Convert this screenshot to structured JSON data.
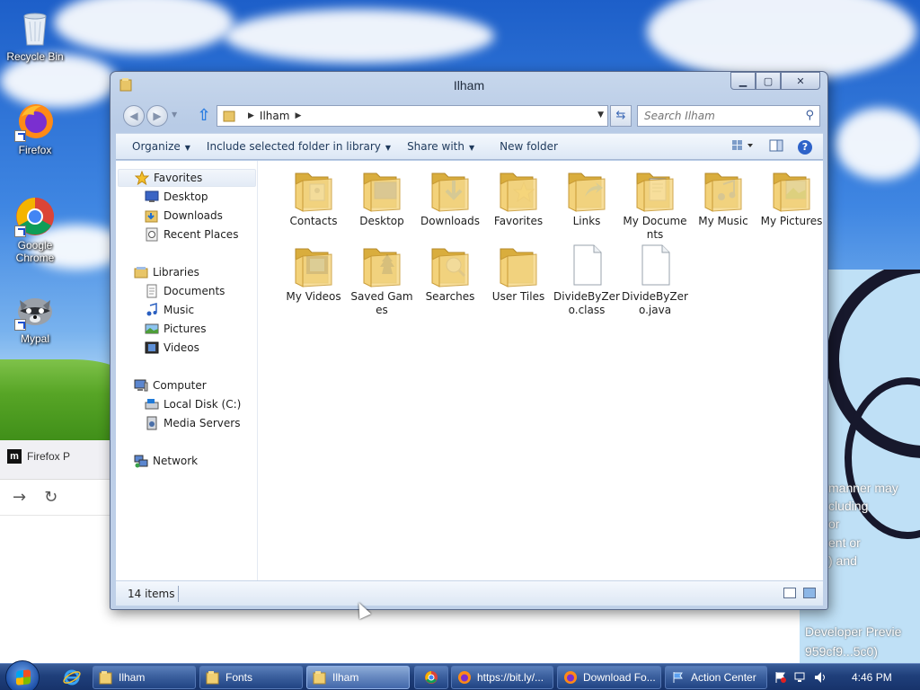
{
  "desktop": {
    "icons": [
      {
        "label": "Recycle Bin"
      },
      {
        "label": "Firefox"
      },
      {
        "label": "Google Chrome"
      },
      {
        "label": "Mypal"
      }
    ],
    "background_text": {
      "lines": [
        "manner may",
        "cluding",
        "or",
        "ent or",
        ") and"
      ],
      "developer_line1": "Developer Previe",
      "developer_line2": "959cf9...5c0)"
    }
  },
  "background_firefox": {
    "tab_label": "Firefox P"
  },
  "explorer": {
    "title": "Ilham",
    "address": {
      "crumb": "Ilham"
    },
    "search": {
      "placeholder": "Search Ilham"
    },
    "toolbar": {
      "organize": "Organize",
      "include": "Include selected folder in library",
      "share": "Share with",
      "new_folder": "New folder"
    },
    "nav": {
      "favorites": "Favorites",
      "desktop": "Desktop",
      "downloads": "Downloads",
      "recent": "Recent Places",
      "libraries": "Libraries",
      "documents": "Documents",
      "music": "Music",
      "pictures": "Pictures",
      "videos": "Videos",
      "computer": "Computer",
      "local_disk": "Local Disk (C:)",
      "media_servers": "Media Servers",
      "network": "Network"
    },
    "files": [
      {
        "label": "Contacts",
        "kind": "folder-contacts"
      },
      {
        "label": "Desktop",
        "kind": "folder-desktop"
      },
      {
        "label": "Downloads",
        "kind": "folder-downloads"
      },
      {
        "label": "Favorites",
        "kind": "folder-favorites"
      },
      {
        "label": "Links",
        "kind": "folder-links"
      },
      {
        "label": "My Documents",
        "kind": "folder-documents"
      },
      {
        "label": "My Music",
        "kind": "folder-music"
      },
      {
        "label": "My Pictures",
        "kind": "folder-pictures"
      },
      {
        "label": "My Videos",
        "kind": "folder-videos"
      },
      {
        "label": "Saved Games",
        "kind": "folder-games"
      },
      {
        "label": "Searches",
        "kind": "folder-searches"
      },
      {
        "label": "User Tiles",
        "kind": "folder"
      },
      {
        "label": "DivideByZero.class",
        "kind": "file"
      },
      {
        "label": "DivideByZero.java",
        "kind": "file"
      }
    ],
    "status": {
      "count": "14 items"
    }
  },
  "taskbar": {
    "buttons": [
      {
        "label": "Ilham",
        "icon": "folder-icon"
      },
      {
        "label": "Fonts",
        "icon": "folder-icon"
      },
      {
        "label": "Ilham",
        "icon": "folder-icon"
      },
      {
        "label": "",
        "icon": "chrome-icon"
      },
      {
        "label": "https://bit.ly/...",
        "icon": "firefox-icon"
      },
      {
        "label": "Download Fo...",
        "icon": "firefox-icon"
      },
      {
        "label": "Action Center",
        "icon": "flag-icon"
      }
    ],
    "clock": "4:46 PM"
  },
  "colors": {
    "folder": "#f3d27a",
    "folder_dark": "#d9ad3d",
    "taskbar": "#1f3f7a"
  }
}
